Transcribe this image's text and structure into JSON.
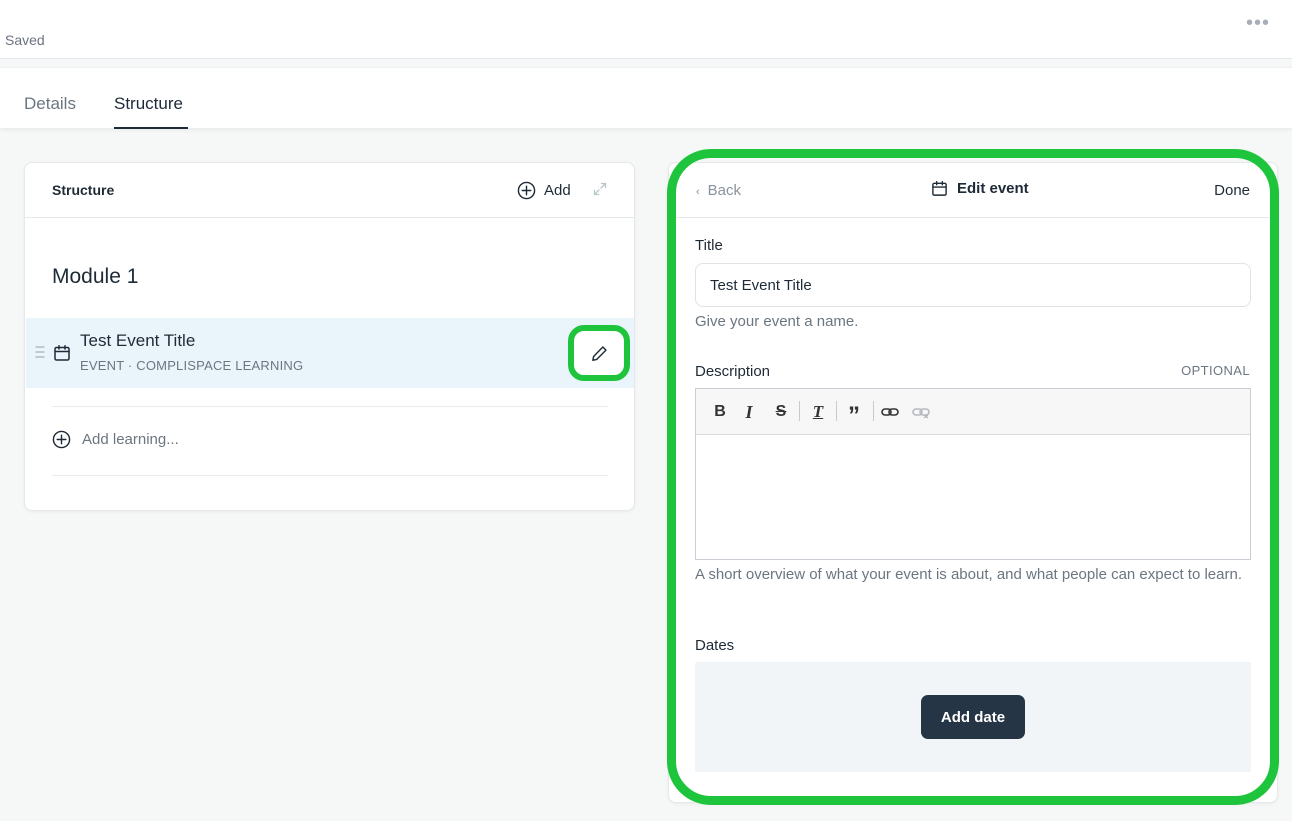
{
  "topbar": {
    "saved_text": "Saved",
    "more_label": "•••"
  },
  "tabs": [
    {
      "label": "Details"
    },
    {
      "label": "Structure"
    }
  ],
  "structure_panel": {
    "title": "Structure",
    "add_label": "Add",
    "module_title": "Module 1",
    "event_item": {
      "title": "Test Event Title",
      "subtitle": "EVENT · COMPLISPACE LEARNING"
    },
    "add_learning_label": "Add learning..."
  },
  "edit_panel": {
    "back_label": "Back",
    "header_title": "Edit event",
    "done_label": "Done",
    "title_label": "Title",
    "title_value": "Test Event Title",
    "title_hint": "Give your event a name.",
    "description_label": "Description",
    "optional_label": "OPTIONAL",
    "description_hint": "A short overview of what your event is about, and what people can expect to learn.",
    "dates_label": "Dates",
    "add_date_label": "Add date"
  },
  "colors": {
    "highlight": "#1ec53c",
    "selected_row": "#eaf5fb",
    "primary_button": "#263545"
  }
}
